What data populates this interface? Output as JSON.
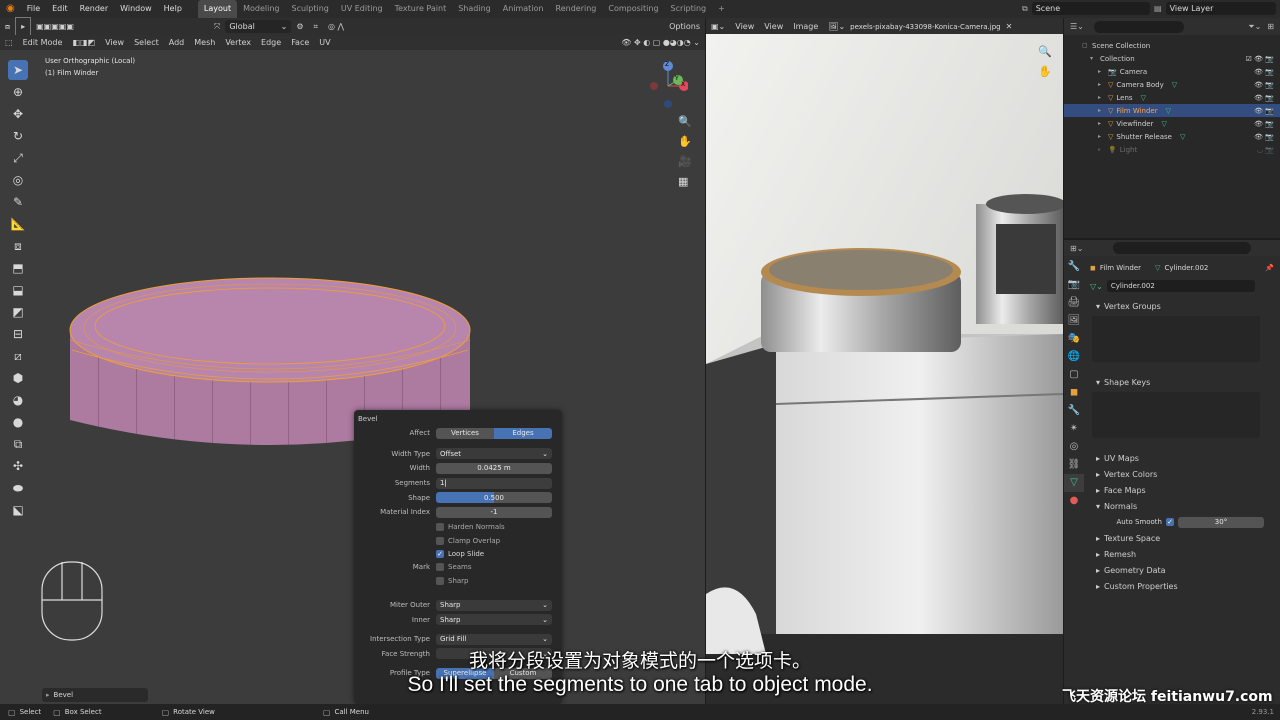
{
  "top_menu": [
    "File",
    "Edit",
    "Render",
    "Window",
    "Help"
  ],
  "workspaces": [
    "Layout",
    "Modeling",
    "Sculpting",
    "UV Editing",
    "Texture Paint",
    "Shading",
    "Animation",
    "Rendering",
    "Compositing",
    "Scripting"
  ],
  "scene_name": "Scene",
  "view_layer": "View Layer",
  "viewport_header": {
    "transform_orientation": "Global",
    "options": "Options",
    "mode": "Edit Mode",
    "menus": [
      "View",
      "Select",
      "Add",
      "Mesh",
      "Vertex",
      "Edge",
      "Face",
      "UV"
    ]
  },
  "viewport_overlay": {
    "view_name": "User Orthographic (Local)",
    "object_name": "(1) Film Winder",
    "gizmo_axes": [
      "Z",
      "Y",
      "X"
    ]
  },
  "image_editor": {
    "menus": [
      "View",
      "View",
      "Image"
    ],
    "image_name": "pexels-pixabay-433098-Konica-Camera.jpg"
  },
  "outliner": {
    "items": [
      {
        "label": "Scene Collection",
        "level": 0
      },
      {
        "label": "Collection",
        "level": 1
      },
      {
        "label": "Camera",
        "level": 2
      },
      {
        "label": "Camera Body",
        "level": 2
      },
      {
        "label": "Lens",
        "level": 2
      },
      {
        "label": "Film Winder",
        "level": 2
      },
      {
        "label": "Viewfinder",
        "level": 2
      },
      {
        "label": "Shutter Release",
        "level": 2
      },
      {
        "label": "Light",
        "level": 2
      }
    ]
  },
  "properties": {
    "object_name": "Film Winder",
    "mesh_name": "Cylinder.002",
    "mesh_field": "Cylinder.002",
    "sections": [
      "Vertex Groups",
      "Shape Keys",
      "UV Maps",
      "Vertex Colors",
      "Face Maps",
      "Normals",
      "Texture Space",
      "Remesh",
      "Geometry Data",
      "Custom Properties"
    ],
    "auto_smooth_label": "Auto Smooth",
    "auto_smooth_angle": "30°"
  },
  "bevel_panel": {
    "title": "Bevel",
    "affect_label": "Affect",
    "affect_vertices": "Vertices",
    "affect_edges": "Edges",
    "width_type_label": "Width Type",
    "width_type": "Offset",
    "width_label": "Width",
    "width": "0.0425 m",
    "segments_label": "Segments",
    "segments": "1",
    "shape_label": "Shape",
    "shape": "0.500",
    "material_index_label": "Material Index",
    "material_index": "-1",
    "harden_normals": "Harden Normals",
    "clamp_overlap": "Clamp Overlap",
    "loop_slide": "Loop Slide",
    "mark_label": "Mark",
    "seams": "Seams",
    "sharp": "Sharp",
    "miter_outer_label": "Miter Outer",
    "miter_outer": "Sharp",
    "inner_label": "Inner",
    "inner": "Sharp",
    "intersection_type_label": "Intersection Type",
    "intersection_type": "Grid Fill",
    "face_strength_label": "Face Strength",
    "profile_type_label": "Profile Type",
    "profile_superellipse": "Superellipse",
    "profile_custom": "Custom"
  },
  "last_operator": "Bevel",
  "status_bar": {
    "select": "Select",
    "box_select": "Box Select",
    "rotate_view": "Rotate View",
    "call_menu": "Call Menu",
    "version": "2.93.1"
  },
  "subtitles": {
    "chinese": "我将分段设置为对象模式的一个选项卡。",
    "english": "So I'll set the segments to one tab to object mode."
  },
  "watermark": "飞天资源论坛 feitianwu7.com",
  "colors": {
    "accent": "#4772b3",
    "selection_outline": "#f0a030",
    "mesh_face": "#b57fa8",
    "selected_row": "#334d80"
  }
}
